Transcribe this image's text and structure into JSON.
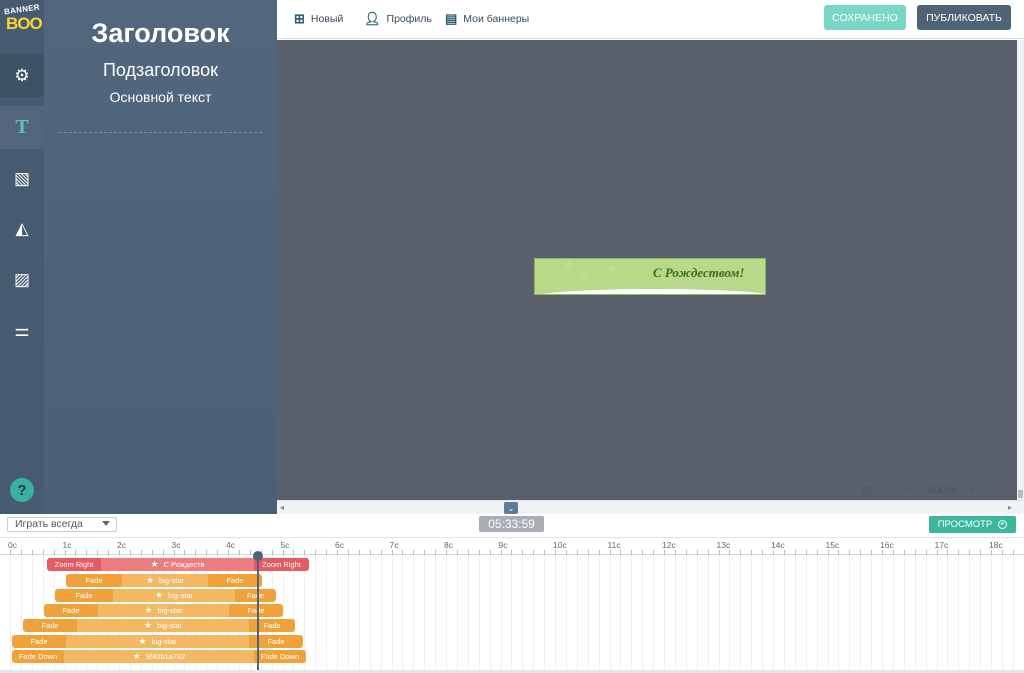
{
  "app": {
    "logo_top": "BANNER",
    "logo_bottom": "BOO"
  },
  "rail": {
    "items": [
      {
        "name": "settings",
        "icon": "gear-icon",
        "glyph": "⚙"
      },
      {
        "name": "text",
        "icon": "text-icon",
        "glyph": "T"
      },
      {
        "name": "backgrounds",
        "icon": "pattern-icon",
        "glyph": "▧"
      },
      {
        "name": "shapes",
        "icon": "shapes-icon",
        "glyph": "◭"
      },
      {
        "name": "images",
        "icon": "image-icon",
        "glyph": "▨"
      },
      {
        "name": "adjust",
        "icon": "sliders-icon",
        "glyph": "⚌"
      }
    ],
    "help": "?"
  },
  "panel": {
    "title": "Заголовок",
    "subtitle": "Подзаголовок",
    "body": "Основной текст"
  },
  "toolbar": {
    "new": "Новый",
    "profile": "Профиль",
    "my_banners": "Мои баннеры",
    "saved": "СОХРАНЕНО",
    "publish": "ПУБЛИКОВАТЬ"
  },
  "banner": {
    "text": "С Рождеством!"
  },
  "zoom": {
    "level": "100%",
    "minus": "−",
    "plus": "+"
  },
  "timeline": {
    "play_mode": "Играть всегда",
    "timecode": "05:33:59",
    "preview": "ПРОСМОТР",
    "ticks": [
      "0c",
      "1c",
      "2c",
      "3c",
      "4c",
      "5c",
      "6c",
      "7c",
      "8c",
      "9c",
      "10c",
      "11c",
      "12c",
      "13c",
      "14c",
      "15c",
      "16c",
      "17c",
      "18c"
    ],
    "tracks": [
      {
        "in": "Zoom Right",
        "name": "С Рождеств",
        "out": "Zoom Right"
      },
      {
        "in": "Fade",
        "name": "big-star",
        "out": "Fade"
      },
      {
        "in": "Fade",
        "name": "big-star",
        "out": "Fade"
      },
      {
        "in": "Fade",
        "name": "big-star",
        "out": "Fade"
      },
      {
        "in": "Fade",
        "name": "big-star",
        "out": "Fade"
      },
      {
        "in": "Fade",
        "name": "big-star",
        "out": "Fade"
      },
      {
        "in": "Fade Down",
        "name": "9f40b1a782",
        "out": "Fade Down"
      }
    ]
  }
}
